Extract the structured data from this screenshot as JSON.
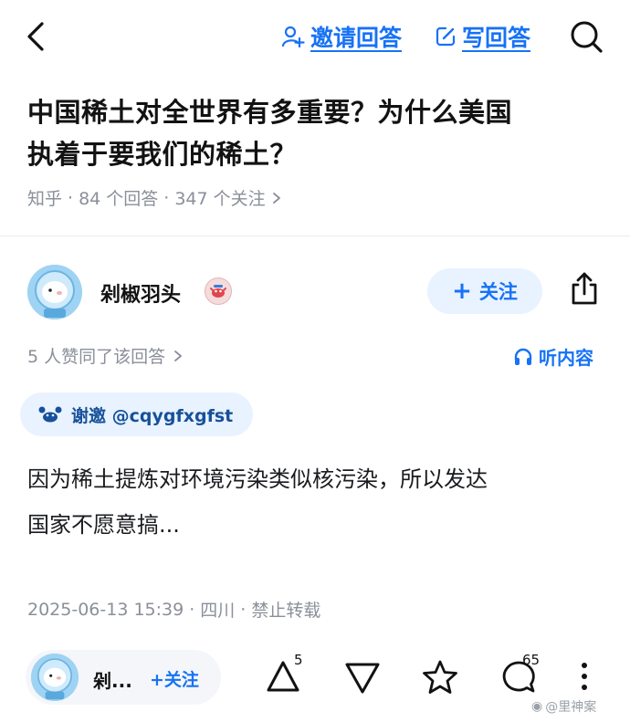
{
  "header": {
    "back_icon": "chevron-left-icon",
    "invite_label": "邀请回答",
    "write_label": "写回答",
    "search_icon": "search-icon"
  },
  "question": {
    "title_line1": "中国稀土对全世界有多重要？为什么美国",
    "title_line2": "执着于要我们的稀土？",
    "source": "知乎",
    "answers": "84 个回答",
    "followers": "347 个关注"
  },
  "author": {
    "name": "剁椒羽头",
    "follow_label": "关注"
  },
  "answer": {
    "likes_text": "5 人赞同了该回答",
    "listen_label": "听内容",
    "thanks_text": "谢邀 @cqygfxgfst",
    "body_line1": "因为稀土提炼对环境污染类似核污染，所以发达",
    "body_line2": "国家不愿意搞...",
    "date": "2025-06-13 15:39",
    "location": "四川",
    "copyright": "禁止转载"
  },
  "bottom_bar": {
    "mini_name": "剁...",
    "mini_follow": "+关注",
    "upvote_count": "5",
    "comment_count": "65"
  },
  "watermark": "@里神案",
  "colors": {
    "accent": "#1772f6",
    "muted": "#8a8f99",
    "pill": "#e9f2ff"
  }
}
